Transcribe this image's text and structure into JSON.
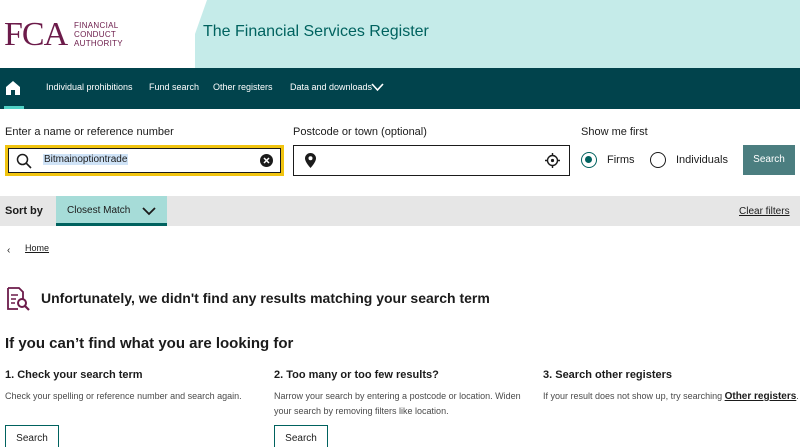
{
  "header": {
    "logo_mark": "FCA",
    "logo_words": [
      "FINANCIAL",
      "CONDUCT",
      "AUTHORITY"
    ],
    "site_title": "The Financial Services Register"
  },
  "nav": {
    "items": [
      "Individual prohibitions",
      "Fund search",
      "Other registers",
      "Data and downloads"
    ]
  },
  "search": {
    "name_label": "Enter a name or reference number",
    "name_value": "Bitmainoptiontrade",
    "location_label": "Postcode or town (optional)",
    "location_value": "",
    "show_first_label": "Show me first",
    "options": [
      "Firms",
      "Individuals"
    ],
    "selected_option": "Firms",
    "button": "Search"
  },
  "sort": {
    "label": "Sort by",
    "selected": "Closest Match",
    "clear_filters": "Clear filters"
  },
  "breadcrumb": {
    "home": "Home"
  },
  "results": {
    "no_results": "Unfortunately, we didn't find any results matching your search term",
    "heading": "If you can’t find what you are looking for",
    "tips": [
      {
        "title": "1. Check your search term",
        "text": "Check your spelling or reference number and search again.",
        "button": "Search"
      },
      {
        "title": "2. Too many or too few results?",
        "text": "Narrow your search by entering a postcode or location. Widen your search by removing filters like location.",
        "button": "Search"
      },
      {
        "title": "3. Search other registers",
        "text": "If your result does not show up, try searching ",
        "link": "Other registers",
        "suffix": "."
      }
    ]
  },
  "colors": {
    "brand": "#6c1b4a",
    "nav": "#01434c",
    "accent": "#00625f",
    "focus": "#f1c40f",
    "header_bg": "#c5ebe9"
  }
}
